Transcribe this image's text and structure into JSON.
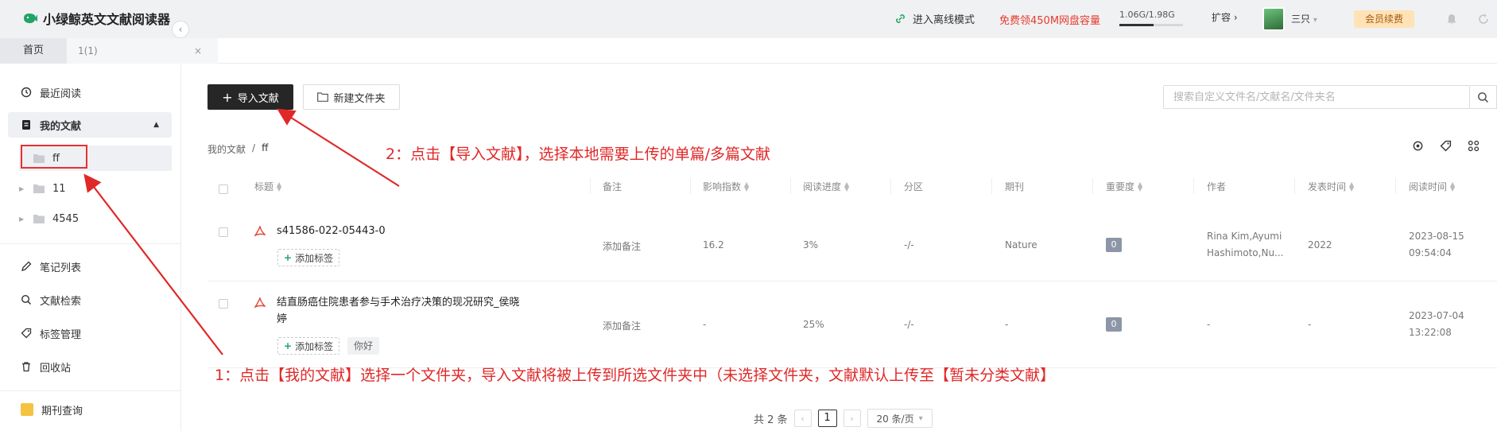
{
  "app": {
    "name": "小绿鲸英文文献阅读器"
  },
  "header": {
    "offline_mode": "进入离线模式",
    "promo": "免费领450M网盘容量",
    "storage": "1.06G/1.98G",
    "storage_fraction": 0.54,
    "expand": "扩容",
    "user": "三只",
    "vip": "会员续费"
  },
  "tabs": {
    "home": "首页",
    "doc": "1(1)",
    "close": "×"
  },
  "sidebar": {
    "recent": "最近阅读",
    "my_docs": "我的文献",
    "folders": [
      "ff",
      "11",
      "4545"
    ],
    "notes": "笔记列表",
    "search": "文献检索",
    "tags": "标签管理",
    "trash": "回收站",
    "journal": "期刊查询"
  },
  "toolbar": {
    "import": "导入文献",
    "new_folder": "新建文件夹"
  },
  "search": {
    "placeholder": "搜索自定义文件名/文献名/文件夹名"
  },
  "breadcrumb": {
    "root": "我的文献",
    "sep": "/",
    "current": "ff"
  },
  "table": {
    "headers": [
      "标题",
      "备注",
      "影响指数",
      "阅读进度",
      "分区",
      "期刊",
      "重要度",
      "作者",
      "发表时间",
      "阅读时间"
    ],
    "rows": [
      {
        "title": "s41586-022-05443-0",
        "tag_add": "添加标签",
        "note": "添加备注",
        "impact": "16.2",
        "progress": "3%",
        "zone": "-/-",
        "journal": "Nature",
        "importance": "0",
        "author_line1": "Rina Kim,Ayumi",
        "author_line2": "Hashimoto,Nu...",
        "pub_year": "2022",
        "read_date": "2023-08-15",
        "read_time": "09:54:04"
      },
      {
        "title_line1": "结直肠癌住院患者参与手术治疗决策的现况研究_侯晓",
        "title_line2": "婷",
        "tag_add": "添加标签",
        "tag": "你好",
        "note": "添加备注",
        "impact": "-",
        "progress": "25%",
        "zone": "-/-",
        "journal": "-",
        "importance": "0",
        "author": "-",
        "pub_year": "-",
        "read_date": "2023-07-04",
        "read_time": "13:22:08"
      }
    ]
  },
  "pager": {
    "total": "共 2 条",
    "current": "1",
    "size": "20 条/页"
  },
  "annotations": {
    "step1": "1：点击【我的文献】选择一个文件夹，导入文献将被上传到所选文件夹中（未选择文件夹，文献默认上传至【暂未分类文献】",
    "step2": "2：点击【导入文献】，选择本地需要上传的单篇/多篇文献"
  },
  "colors": {
    "annotation": "#e02828",
    "promo": "#e83a2e",
    "primary_button": "#262626"
  }
}
